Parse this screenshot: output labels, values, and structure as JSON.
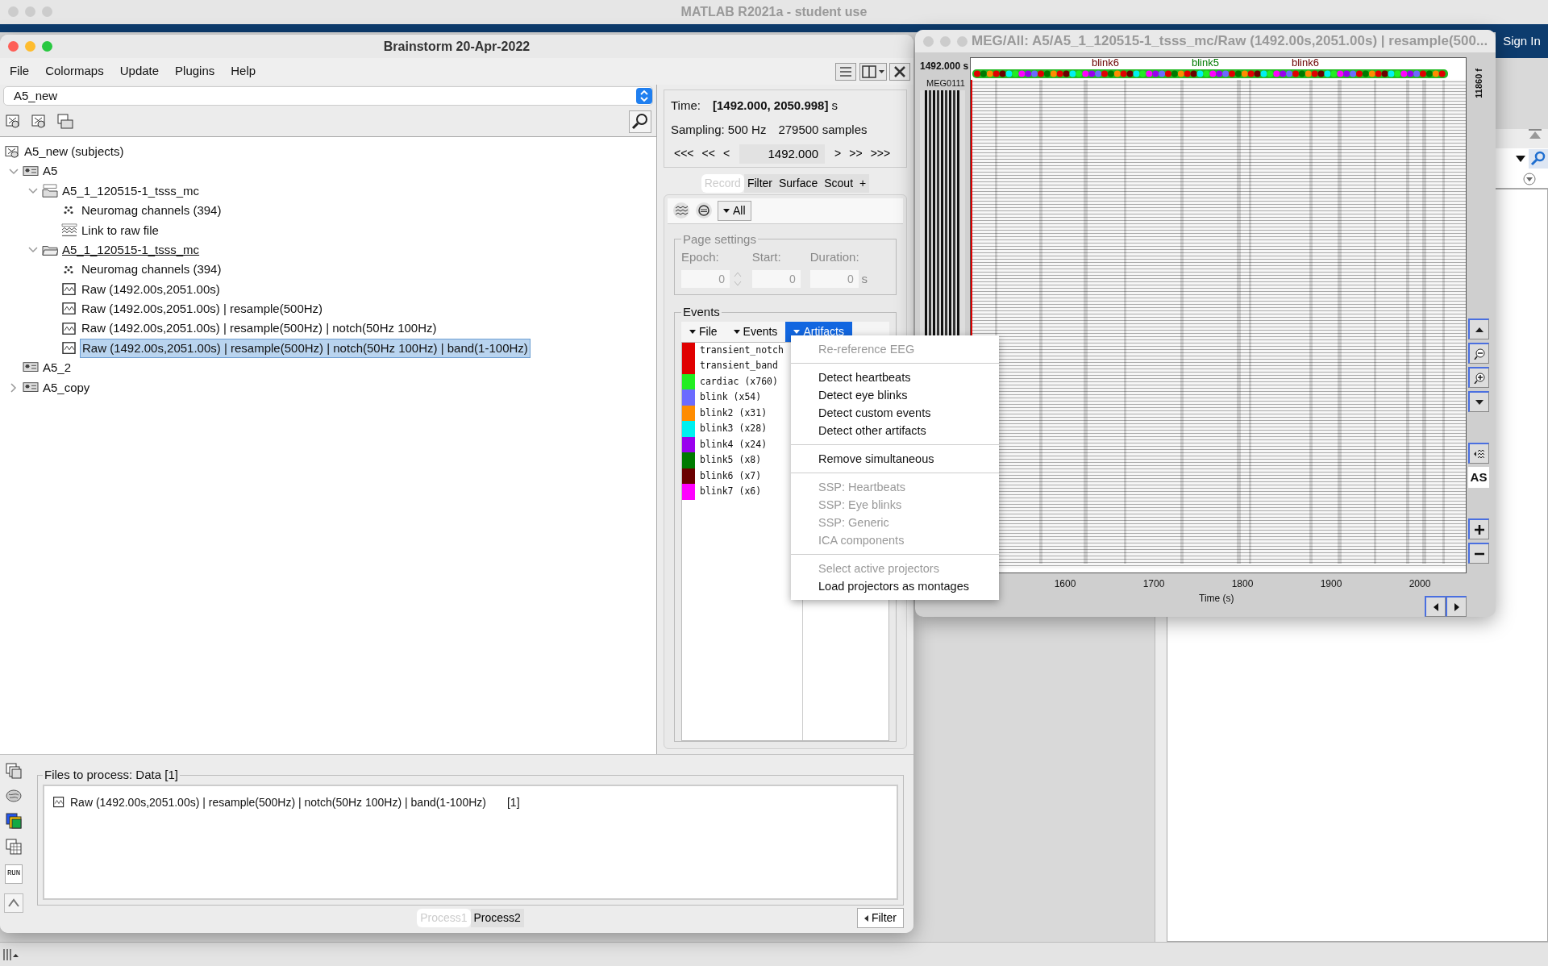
{
  "matlab": {
    "title": "MATLAB R2021a - student use",
    "sign_in": "Sign In"
  },
  "brainstorm": {
    "title": "Brainstorm 20-Apr-2022",
    "menu": [
      "File",
      "Colormaps",
      "Update",
      "Plugins",
      "Help"
    ],
    "protocol": "A5_new",
    "tree": [
      {
        "label": "A5_new (subjects)",
        "kind": "subjects",
        "selected": false,
        "children": [
          {
            "label": "A5",
            "kind": "subject",
            "selected": false,
            "expanded": true,
            "children": [
              {
                "label": "A5_1_120515-1_tsss_mc",
                "kind": "raw-folder",
                "selected": false,
                "current": false,
                "expanded": true,
                "children": [
                  {
                    "label": "Neuromag channels (394)",
                    "kind": "channels",
                    "selected": false
                  },
                  {
                    "label": "Link to raw file",
                    "kind": "raw-link",
                    "selected": false
                  }
                ]
              },
              {
                "label": "A5_1_120515-1_tsss_mc",
                "kind": "folder",
                "selected": false,
                "current": true,
                "expanded": true,
                "children": [
                  {
                    "label": "Neuromag channels (394)",
                    "kind": "channels",
                    "selected": false
                  },
                  {
                    "label": "Raw (1492.00s,2051.00s)",
                    "kind": "data",
                    "selected": false
                  },
                  {
                    "label": "Raw (1492.00s,2051.00s) | resample(500Hz)",
                    "kind": "data",
                    "selected": false
                  },
                  {
                    "label": "Raw (1492.00s,2051.00s) | resample(500Hz) | notch(50Hz 100Hz)",
                    "kind": "data",
                    "selected": false
                  },
                  {
                    "label": "Raw (1492.00s,2051.00s) | resample(500Hz) | notch(50Hz 100Hz) | band(1-100Hz)",
                    "kind": "data",
                    "selected": true
                  }
                ]
              }
            ]
          },
          {
            "label": "A5_2",
            "kind": "subject",
            "selected": false
          },
          {
            "label": "A5_copy",
            "kind": "subject",
            "selected": false,
            "expanded": false
          }
        ]
      }
    ],
    "time": {
      "label": "Time:",
      "value": "[1492.000, 2050.998]",
      "unit": "s"
    },
    "sampling": "Sampling: 500 Hz",
    "samples": "279500 samples",
    "nav_left": [
      "<<<",
      "<<",
      "<"
    ],
    "time_field": "1492.000",
    "nav_right": [
      ">",
      ">>",
      ">>>"
    ],
    "tabs": [
      {
        "label": "Record",
        "selected": true
      },
      {
        "label": "Filter",
        "selected": false
      },
      {
        "label": "Surface",
        "selected": false
      },
      {
        "label": "Scout",
        "selected": false
      },
      {
        "label": "+",
        "selected": false
      }
    ],
    "montage": "All",
    "page_settings": {
      "title": "Page settings",
      "disabled": true,
      "fields": [
        {
          "label": "Epoch:",
          "value": "0",
          "kind": "spinner"
        },
        {
          "label": "Start:",
          "value": "0",
          "kind": "plain"
        },
        {
          "label": "Duration:",
          "value": "0",
          "kind": "plain",
          "unit": "s"
        }
      ]
    },
    "events": {
      "title": "Events",
      "menus": [
        {
          "label": "File",
          "open": false
        },
        {
          "label": "Events",
          "open": false
        },
        {
          "label": "Artifacts",
          "open": true
        }
      ],
      "list": [
        {
          "label": "transient_notch",
          "color": "#e00000"
        },
        {
          "label": "transient_band",
          "color": "#e00000"
        },
        {
          "label": "cardiac  (x760)",
          "color": "#22ee22"
        },
        {
          "label": "blink  (x54)",
          "color": "#6b6bff"
        },
        {
          "label": "blink2  (x31)",
          "color": "#ff8c00"
        },
        {
          "label": "blink3  (x28)",
          "color": "#00f0f0"
        },
        {
          "label": "blink4  (x24)",
          "color": "#9900ee"
        },
        {
          "label": "blink5  (x8)",
          "color": "#007a00"
        },
        {
          "label": "blink6  (x7)",
          "color": "#6b0000"
        },
        {
          "label": "blink7  (x6)",
          "color": "#ff00ff"
        }
      ]
    },
    "artifacts_menu": [
      {
        "kind": "item",
        "label": "Re-reference EEG",
        "disabled": true
      },
      {
        "kind": "separator"
      },
      {
        "kind": "item",
        "label": "Detect heartbeats",
        "disabled": false
      },
      {
        "kind": "item",
        "label": "Detect eye blinks",
        "disabled": false
      },
      {
        "kind": "item",
        "label": "Detect custom events",
        "disabled": false
      },
      {
        "kind": "item",
        "label": "Detect other artifacts",
        "disabled": false
      },
      {
        "kind": "separator"
      },
      {
        "kind": "item",
        "label": "Remove simultaneous",
        "disabled": false
      },
      {
        "kind": "separator"
      },
      {
        "kind": "item",
        "label": "SSP: Heartbeats",
        "disabled": true
      },
      {
        "kind": "item",
        "label": "SSP: Eye blinks",
        "disabled": true
      },
      {
        "kind": "item",
        "label": "SSP: Generic",
        "disabled": true
      },
      {
        "kind": "item",
        "label": "ICA components",
        "disabled": true
      },
      {
        "kind": "separator"
      },
      {
        "kind": "item",
        "label": "Select active projectors",
        "disabled": true
      },
      {
        "kind": "item",
        "label": "Load projectors as montages",
        "disabled": false
      }
    ],
    "process": {
      "title": "Files to process: Data [1]",
      "files": [
        {
          "label": "Raw (1492.00s,2051.00s) | resample(500Hz) | notch(50Hz 100Hz) | band(1-100Hz)",
          "count": "[1]"
        }
      ],
      "run": "RUN",
      "tabs": [
        {
          "label": "Process1",
          "selected": true
        },
        {
          "label": "Process2",
          "selected": false
        }
      ],
      "filter": "Filter"
    }
  },
  "viewer": {
    "title": "MEG/All: A5/A5_1_120515-1_tsss_mc/Raw (1492.00s,2051.00s) | resample(500...",
    "time": "1492.000 s",
    "channel": "MEG0111",
    "scale": "11860 f",
    "event_labels": [
      {
        "label": "blink6",
        "color": "#6b0000"
      },
      {
        "label": "blink5",
        "color": "#007a00"
      },
      {
        "label": "blink6",
        "color": "#6b0000"
      }
    ],
    "xticks": [
      "1600",
      "1700",
      "1800",
      "1900",
      "2000"
    ],
    "xlabel": "Time (s)",
    "as_button": "AS"
  }
}
